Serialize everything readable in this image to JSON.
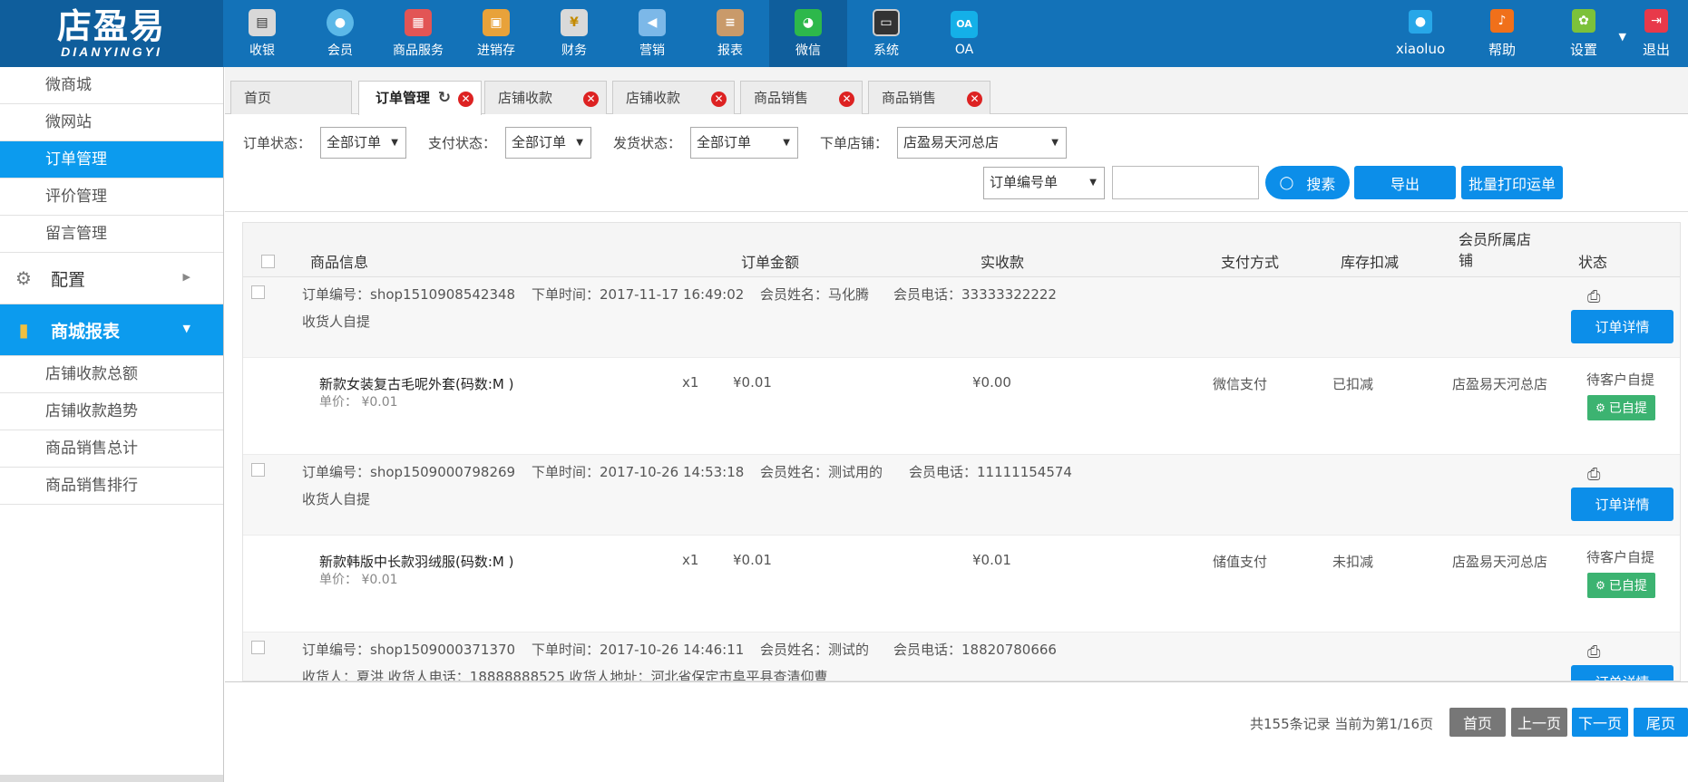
{
  "logo": {
    "main": "店盈易",
    "sub": "DIANYINGYI"
  },
  "topnav": [
    {
      "label": "收银",
      "icon": "cash-register-icon",
      "color": "#d8d8d8"
    },
    {
      "label": "会员",
      "icon": "member-icon",
      "color": "#5bb8e8"
    },
    {
      "label": "商品服务",
      "icon": "goods-service-icon",
      "color": "#e25555"
    },
    {
      "label": "进销存",
      "icon": "inventory-icon",
      "color": "#e8a23a"
    },
    {
      "label": "财务",
      "icon": "finance-icon",
      "color": "#d9d9d9"
    },
    {
      "label": "营销",
      "icon": "marketing-icon",
      "color": "#7cb8e8"
    },
    {
      "label": "报表",
      "icon": "report-icon",
      "color": "#c99a6a"
    },
    {
      "label": "微信",
      "icon": "wechat-icon",
      "color": "#2db84b"
    },
    {
      "label": "系统",
      "icon": "system-icon",
      "color": "#333333"
    },
    {
      "label": "OA",
      "icon": "oa-icon",
      "color": "#14b0e8"
    }
  ],
  "righttools": {
    "user": "xiaoluo",
    "help": "帮助",
    "settings": "设置",
    "logout": "退出"
  },
  "sidebar": {
    "wechat_items": [
      "微商城",
      "微网站",
      "订单管理",
      "评价管理",
      "留言管理"
    ],
    "config_group": "配置",
    "report_group": "商城报表",
    "report_items": [
      "店铺收款总额",
      "店铺收款趋势",
      "商品销售总计",
      "商品销售排行"
    ]
  },
  "tabs": [
    {
      "label": "首页"
    },
    {
      "label": "订单管理"
    },
    {
      "label": "店铺收款"
    },
    {
      "label": "店铺收款"
    },
    {
      "label": "商品销售"
    },
    {
      "label": "商品销售"
    }
  ],
  "filters": {
    "order_status_label": "订单状态：",
    "order_status_value": "全部订单",
    "pay_status_label": "支付状态：",
    "pay_status_value": "全部订单",
    "ship_status_label": "发货状态：",
    "ship_status_value": "全部订单",
    "shop_label": "下单店铺：",
    "shop_value": "店盈易天河总店",
    "search_type_value": "订单编号单",
    "search_button": "搜素",
    "export_button": "导出",
    "batch_print_button": "批量打印运单"
  },
  "table": {
    "headers": {
      "product": "商品信息",
      "amount": "订单金额",
      "received": "实收款",
      "pay_method": "支付方式",
      "stock": "库存扣减",
      "shop_line1": "会员所属店",
      "shop_line2": "铺",
      "status": "状态"
    },
    "detail_button": "订单详情",
    "orders": [
      {
        "order_no": "订单编号：shop1510908542348",
        "order_time": "下单时间：2017-11-17 16:49:02",
        "member_name": "会员姓名：马化腾",
        "member_phone": "会员电话：33333322222",
        "receiver": "收货人自提",
        "product_name": "新款女装复古毛呢外套(码数:M )",
        "unit_price": "单价： ¥0.01",
        "qty": "x1",
        "amount": "¥0.01",
        "received": "¥0.00",
        "pay_method": "微信支付",
        "stock": "已扣减",
        "shop": "店盈易天河总店",
        "status": "待客户自提",
        "badge": "已自提"
      },
      {
        "order_no": "订单编号：shop1509000798269",
        "order_time": "下单时间：2017-10-26 14:53:18",
        "member_name": "会员姓名：测试用的",
        "member_phone": "会员电话：11111154574",
        "receiver": "收货人自提",
        "product_name": "新款韩版中长款羽绒服(码数:M )",
        "unit_price": "单价： ¥0.01",
        "qty": "x1",
        "amount": "¥0.01",
        "received": "¥0.01",
        "pay_method": "储值支付",
        "stock": "未扣减",
        "shop": "店盈易天河总店",
        "status": "待客户自提",
        "badge": "已自提"
      },
      {
        "order_no": "订单编号：shop1509000371370",
        "order_time": "下单时间：2017-10-26 14:46:11",
        "member_name": "会员姓名：测试的",
        "member_phone": "会员电话：18820780666",
        "receiver": "收货人：夏洪    收货人电话：18888888525    收货人地址：河北省保定市阜平县查清仰曹"
      }
    ]
  },
  "pagination": {
    "info": "共155条记录 当前为第1/16页",
    "first": "首页",
    "prev": "上一页",
    "next": "下一页",
    "last": "尾页"
  }
}
